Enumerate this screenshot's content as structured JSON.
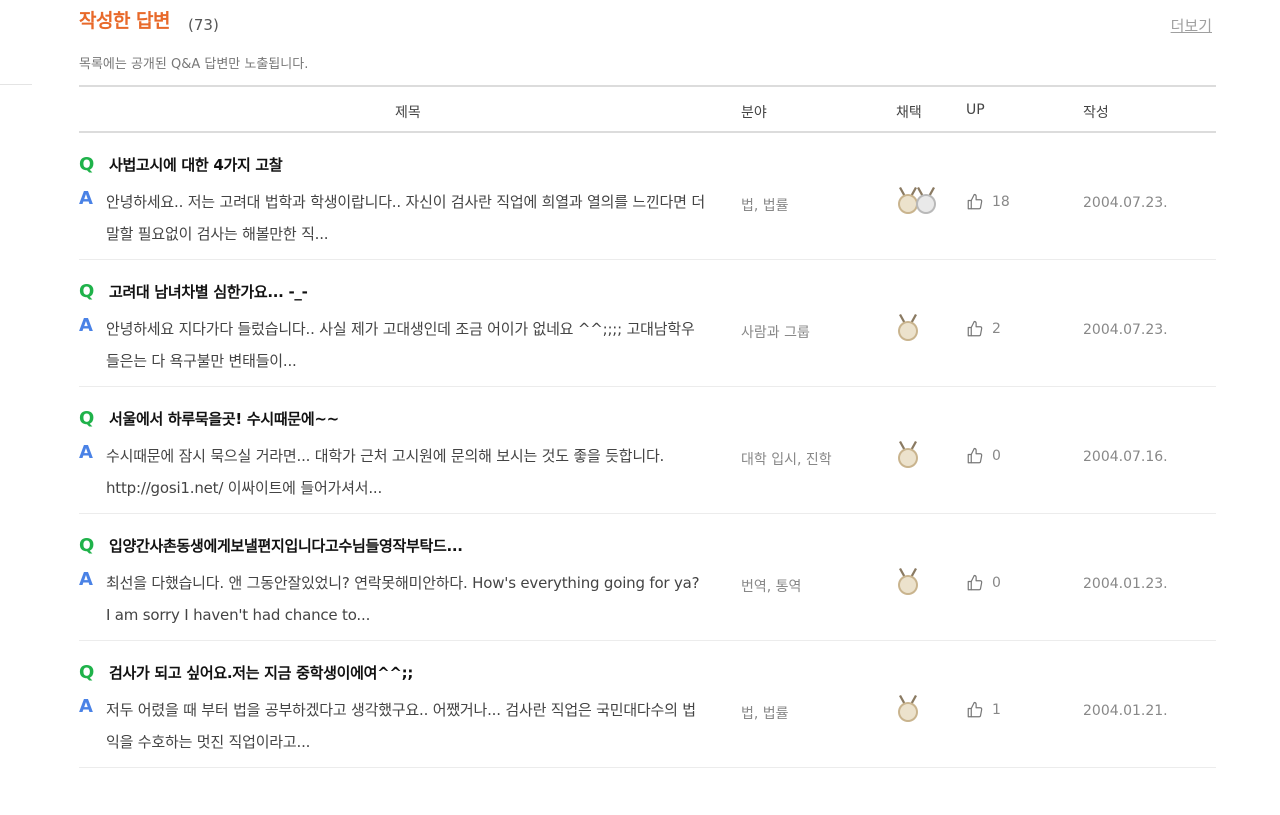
{
  "header": {
    "title": "작성한 답변",
    "count": "(73)",
    "more": "더보기",
    "notice": "목록에는 공개된 Q&A 답변만 노출됩니다."
  },
  "table": {
    "columns": {
      "title": "제목",
      "field": "분야",
      "pick": "채택",
      "up": "UP",
      "date": "작성"
    },
    "q_mark": "Q",
    "a_mark": "A",
    "rows": [
      {
        "question": "사법고시에 대한 4가지 고찰",
        "answer": "안녕하세요.. 저는 고려대 법학과 학생이랍니다.. 자신이 검사란 직업에 희열과 열의를 느낀다면 더 말할 필요없이 검사는 해볼만한 직...",
        "field": "법, 법률",
        "medals": [
          "gold",
          "silver"
        ],
        "up": "18",
        "date": "2004.07.23."
      },
      {
        "question": "고려대 남녀차별 심한가요... -_-",
        "answer": "안녕하세요 지다가다 들렀습니다.. 사실 제가 고대생인데 조금 어이가 없네요 ^^;;;; 고대남학우들은는 다 욕구불만 변태들이...",
        "field": "사람과 그룹",
        "medals": [
          "gold"
        ],
        "up": "2",
        "date": "2004.07.23."
      },
      {
        "question": "서울에서 하루묵을곳! 수시때문에~~",
        "answer": "수시때문에 잠시 묵으실 거라면... 대학가 근처 고시원에 문의해 보시는 것도 좋을 듯합니다. http://gosi1.net/ 이싸이트에 들어가셔서...",
        "field": "대학 입시, 진학",
        "medals": [
          "gold"
        ],
        "up": "0",
        "date": "2004.07.16."
      },
      {
        "question": "입양간사촌동생에게보낼편지입니다고수님들영작부탁드...",
        "answer": "최선을 다했습니다. 앤 그동안잘있었니? 연락못해미안하다. How's everything going for ya? I am sorry I haven't had chance to...",
        "field": "번역, 통역",
        "medals": [
          "gold"
        ],
        "up": "0",
        "date": "2004.01.23."
      },
      {
        "question": "검사가 되고 싶어요.저는 지금 중학생이에여^^;;",
        "answer": "저두 어렸을 때 부터 법을 공부하겠다고 생각했구요.. 어쨌거나... 검사란 직업은 국민대다수의 법익을 수호하는 멋진 직업이라고...",
        "field": "법, 법률",
        "medals": [
          "gold"
        ],
        "up": "1",
        "date": "2004.01.21."
      }
    ]
  },
  "colors": {
    "title": "#e8692a",
    "q": "#1fb24a",
    "a": "#4a82e6"
  },
  "icons": {
    "up": "thumbs-up-icon",
    "medal": "medal-icon"
  }
}
